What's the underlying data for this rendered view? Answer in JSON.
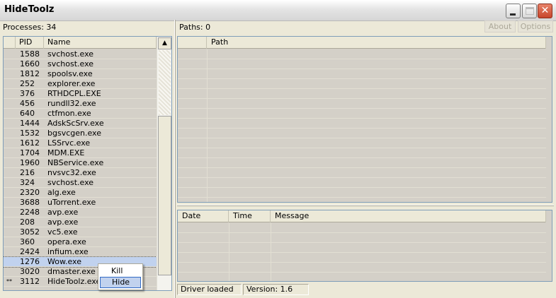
{
  "window": {
    "title": "HideToolz"
  },
  "processes": {
    "label": "Processes: 34",
    "columns": [
      "PID",
      "Name"
    ],
    "rows": [
      {
        "mark": "",
        "pid": "1588",
        "name": "svchost.exe"
      },
      {
        "mark": "",
        "pid": "1660",
        "name": "svchost.exe"
      },
      {
        "mark": "",
        "pid": "1812",
        "name": "spoolsv.exe"
      },
      {
        "mark": "",
        "pid": "252",
        "name": "explorer.exe"
      },
      {
        "mark": "",
        "pid": "376",
        "name": "RTHDCPL.EXE"
      },
      {
        "mark": "",
        "pid": "456",
        "name": "rundll32.exe"
      },
      {
        "mark": "",
        "pid": "640",
        "name": "ctfmon.exe"
      },
      {
        "mark": "",
        "pid": "1444",
        "name": "AdskScSrv.exe"
      },
      {
        "mark": "",
        "pid": "1532",
        "name": "bgsvcgen.exe"
      },
      {
        "mark": "",
        "pid": "1612",
        "name": "LSSrvc.exe"
      },
      {
        "mark": "",
        "pid": "1704",
        "name": "MDM.EXE"
      },
      {
        "mark": "",
        "pid": "1960",
        "name": "NBService.exe"
      },
      {
        "mark": "",
        "pid": "216",
        "name": "nvsvc32.exe"
      },
      {
        "mark": "",
        "pid": "324",
        "name": "svchost.exe"
      },
      {
        "mark": "",
        "pid": "2320",
        "name": "alg.exe"
      },
      {
        "mark": "",
        "pid": "3688",
        "name": "uTorrent.exe"
      },
      {
        "mark": "",
        "pid": "2248",
        "name": "avp.exe"
      },
      {
        "mark": "",
        "pid": "208",
        "name": "avp.exe"
      },
      {
        "mark": "",
        "pid": "3052",
        "name": "vc5.exe"
      },
      {
        "mark": "",
        "pid": "360",
        "name": "opera.exe"
      },
      {
        "mark": "",
        "pid": "2424",
        "name": "infium.exe"
      },
      {
        "mark": "",
        "pid": "1276",
        "name": "Wow.exe",
        "selected": true
      },
      {
        "mark": "",
        "pid": "3020",
        "name": "dmaster.exe"
      },
      {
        "mark": "**",
        "pid": "3112",
        "name": "HideToolz.exe"
      }
    ]
  },
  "paths": {
    "label": "Paths: 0",
    "columns": [
      "Path"
    ]
  },
  "buttons": {
    "about": "About",
    "options": "Options"
  },
  "messages": {
    "columns": [
      "Date",
      "Time",
      "Message"
    ]
  },
  "status": {
    "driver": "Driver loaded",
    "version": "Version: 1.6"
  },
  "context_menu": {
    "items": [
      "Kill",
      "Hide"
    ],
    "highlighted": "Hide"
  },
  "icons": {
    "scroll_up": "arrow-up-icon",
    "scroll_down": "arrow-down-icon",
    "minimize": "minimize-icon",
    "maximize": "maximize-icon",
    "close": "close-icon"
  }
}
